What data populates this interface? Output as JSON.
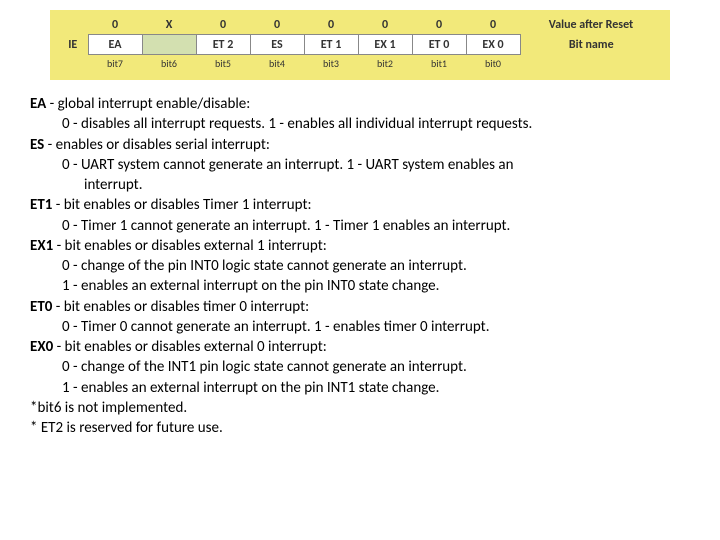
{
  "register": {
    "name": "IE",
    "top_values": [
      "0",
      "X",
      "0",
      "0",
      "0",
      "0",
      "0",
      "0"
    ],
    "bit_names": [
      "EA",
      "",
      "ET 2",
      "ES",
      "ET 1",
      "EX 1",
      "ET 0",
      "EX 0"
    ],
    "bit_nums": [
      "bit7",
      "bit6",
      "bit5",
      "bit4",
      "bit3",
      "bit2",
      "bit1",
      "bit0"
    ],
    "side_top": "Value after Reset",
    "side_mid": "Bit name"
  },
  "desc": {
    "ea_head": "EA",
    "ea_tail": " - global interrupt enable/disable:",
    "ea_line": "0 - disables all interrupt requests. 1 - enables all individual interrupt requests.",
    "es_head": "ES",
    "es_tail": " - enables or disables serial interrupt:",
    "es_line1": "0 - UART system cannot generate an interrupt. 1 - UART system enables an",
    "es_line2": "interrupt.",
    "et1_head": "ET1",
    "et1_tail": " - bit enables or disables Timer 1 interrupt:",
    "et1_line": "0 - Timer 1 cannot generate an interrupt. 1 - Timer 1 enables an interrupt.",
    "ex1_head": "EX1",
    "ex1_tail": " - bit enables or disables external 1 interrupt:",
    "ex1_line1": "0 - change of the pin INT0 logic state cannot generate an interrupt.",
    "ex1_line2": "1 - enables an external interrupt on the pin INT0 state change.",
    "et0_head": "ET0",
    "et0_tail": " - bit enables or disables timer 0 interrupt:",
    "et0_line": "0 - Timer 0 cannot generate an interrupt. 1 - enables timer 0 interrupt.",
    "ex0_head": "EX0",
    "ex0_tail": " - bit enables or disables external 0 interrupt:",
    "ex0_line1": "0 - change of the INT1 pin logic state cannot generate an interrupt.",
    "ex0_line2": "1 - enables an external interrupt on the pin INT1 state change.",
    "note1": "*bit6 is not implemented.",
    "note2": "* ET2 is reserved for future use."
  }
}
